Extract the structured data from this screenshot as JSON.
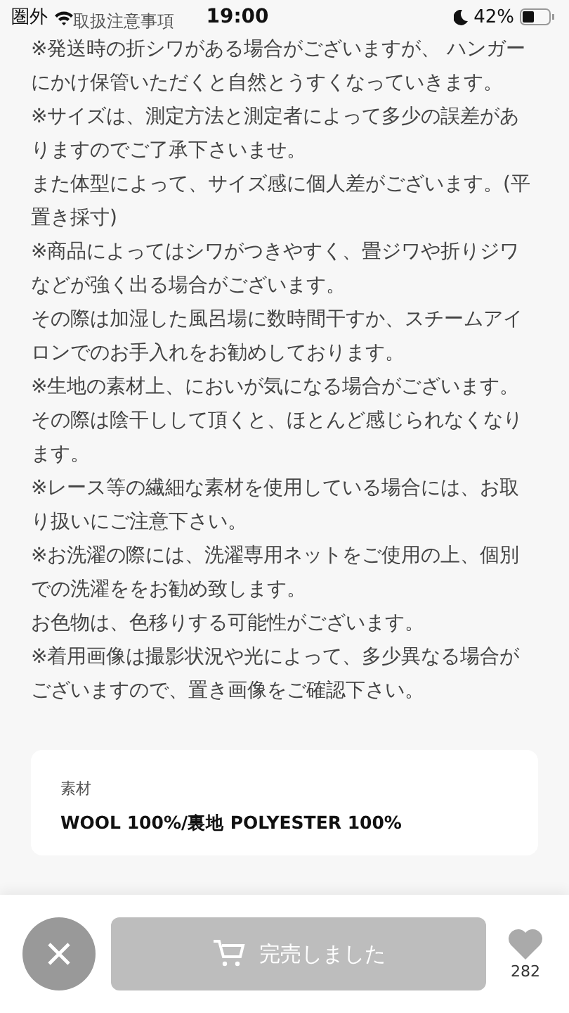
{
  "status_bar": {
    "carrier": "圏外",
    "time": "19:00",
    "battery": "42%"
  },
  "heading": "取扱注意事項",
  "paragraphs": [
    "※発送時の折シワがある場合がございますが、 ハンガーにかけ保管いただくと自然とうすくなっていきます。",
    "※サイズは、測定方法と測定者によって多少の誤差がありますのでご了承下さいませ。",
    "また体型によって、サイズ感に個人差がございます。(平置き採寸)",
    "※商品によってはシワがつきやすく、畳ジワや折りジワなどが強く出る場合がございます。",
    "その際は加湿した風呂場に数時間干すか、スチームアイロンでのお手入れをお勧めしております。",
    "※生地の素材上、においが気になる場合がございます。",
    "その際は陰干しして頂くと、ほとんど感じられなくなります。",
    "※レース等の繊細な素材を使用している場合には、お取り扱いにご注意下さい。",
    "※お洗濯の際には、洗濯専用ネットをご使用の上、個別での洗濯ををお勧め致します。",
    "お色物は、色移りする可能性がございます。",
    "※着用画像は撮影状況や光によって、多少異なる場合がございますので、置き画像をご確認下さい。"
  ],
  "material": {
    "label": "素材",
    "value": "WOOL 100%/裏地 POLYESTER 100%"
  },
  "bottom_bar": {
    "cart_button": {
      "label": "完売しました",
      "disabled": true
    },
    "favorite_count": "282"
  }
}
